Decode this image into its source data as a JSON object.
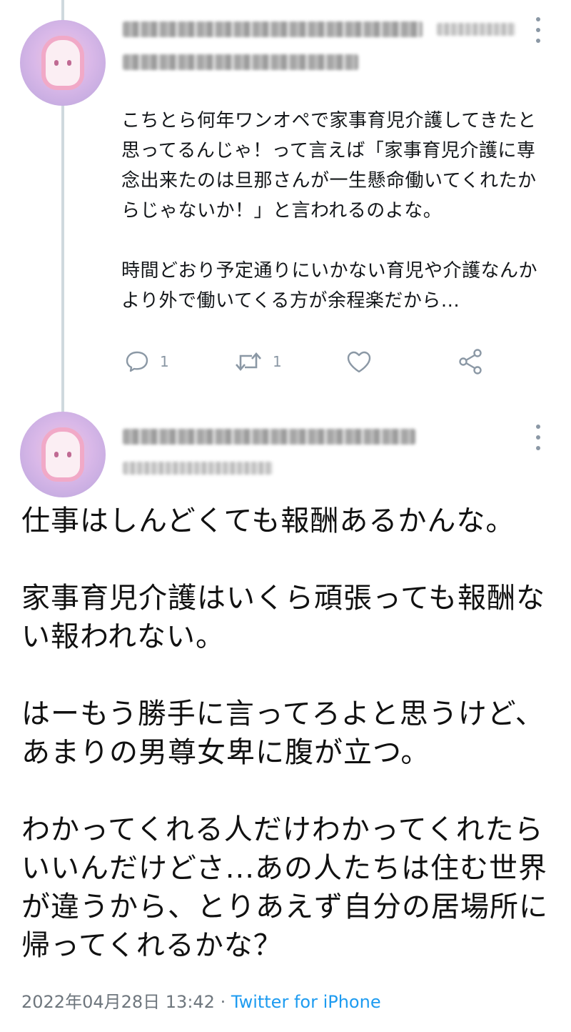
{
  "reply_tweet": {
    "avatar": "user-avatar",
    "paragraphs": [
      "こちとら何年ワンオペで家事育児介護してきたと思ってるんじゃ！って言えば「家事育児介護に専念出来たのは旦那さんが一生懸命働いてくれたからじゃないか！」と言われるのよな。",
      "時間どおり予定通りにいかない育児や介護なんかより外で働いてくる方が余程楽だから..."
    ],
    "actions": {
      "reply_count": "1",
      "retweet_count": "1",
      "like_count": "",
      "icons": [
        "reply-icon",
        "retweet-icon",
        "like-icon",
        "share-icon"
      ]
    }
  },
  "main_tweet": {
    "avatar": "user-avatar",
    "paragraphs": [
      "仕事はしんどくても報酬あるかんな。",
      "家事育児介護はいくら頑張っても報酬ない報われない。",
      "はーもう勝手に言ってろよと思うけど、あまりの男尊女卑に腹が立つ。",
      "わかってくれる人だけわかってくれたらいいんだけどさ...あの人たちは住む世界が違うから、とりあえず自分の居場所に帰ってくれるかな？"
    ],
    "timestamp": "2022年04月28日 13:42",
    "separator": "·",
    "source": "Twitter for iPhone"
  },
  "colors": {
    "accent": "#1d9bf0",
    "muted": "#8b98a5",
    "thread_line": "#cfd9de"
  }
}
